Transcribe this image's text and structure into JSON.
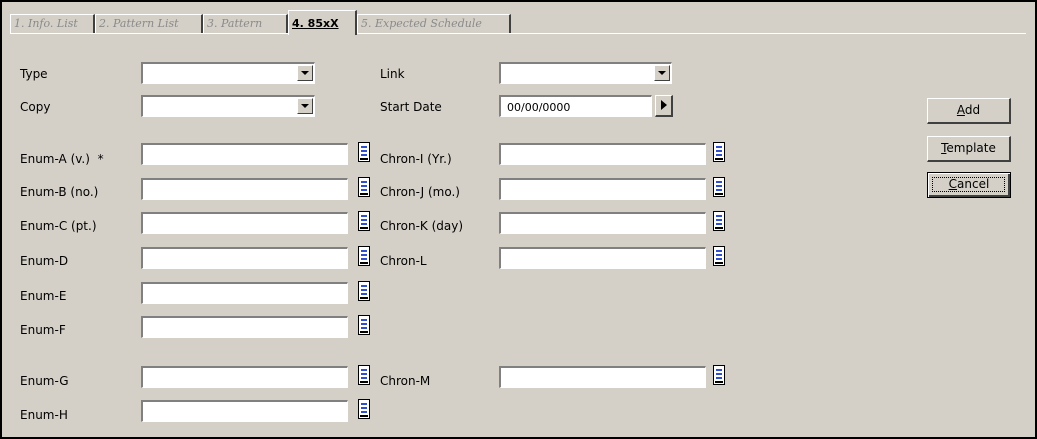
{
  "tabs": [
    {
      "label": "1. Info. List"
    },
    {
      "label": "2. Pattern List"
    },
    {
      "label": "3. Pattern"
    },
    {
      "label": "4. 85xX"
    },
    {
      "label": "5. Expected Schedule"
    }
  ],
  "form": {
    "type_label": "Type",
    "copy_label": "Copy",
    "link_label": "Link",
    "start_date_label": "Start Date",
    "start_date_value": "00/00/0000",
    "enum_a_label": "Enum-A (v.)",
    "required_marker": "*",
    "enum_b_label": "Enum-B (no.)",
    "enum_c_label": "Enum-C (pt.)",
    "enum_d_label": "Enum-D",
    "enum_e_label": "Enum-E",
    "enum_f_label": "Enum-F",
    "enum_g_label": "Enum-G",
    "enum_h_label": "Enum-H",
    "chron_i_label": "Chron-I (Yr.)",
    "chron_j_label": "Chron-J (mo.)",
    "chron_k_label": "Chron-K (day)",
    "chron_l_label": "Chron-L",
    "chron_m_label": "Chron-M"
  },
  "buttons": {
    "add_first": "A",
    "add_rest": "dd",
    "template_first": "T",
    "template_rest": "emplate",
    "cancel_first": "C",
    "cancel_rest": "ancel"
  }
}
